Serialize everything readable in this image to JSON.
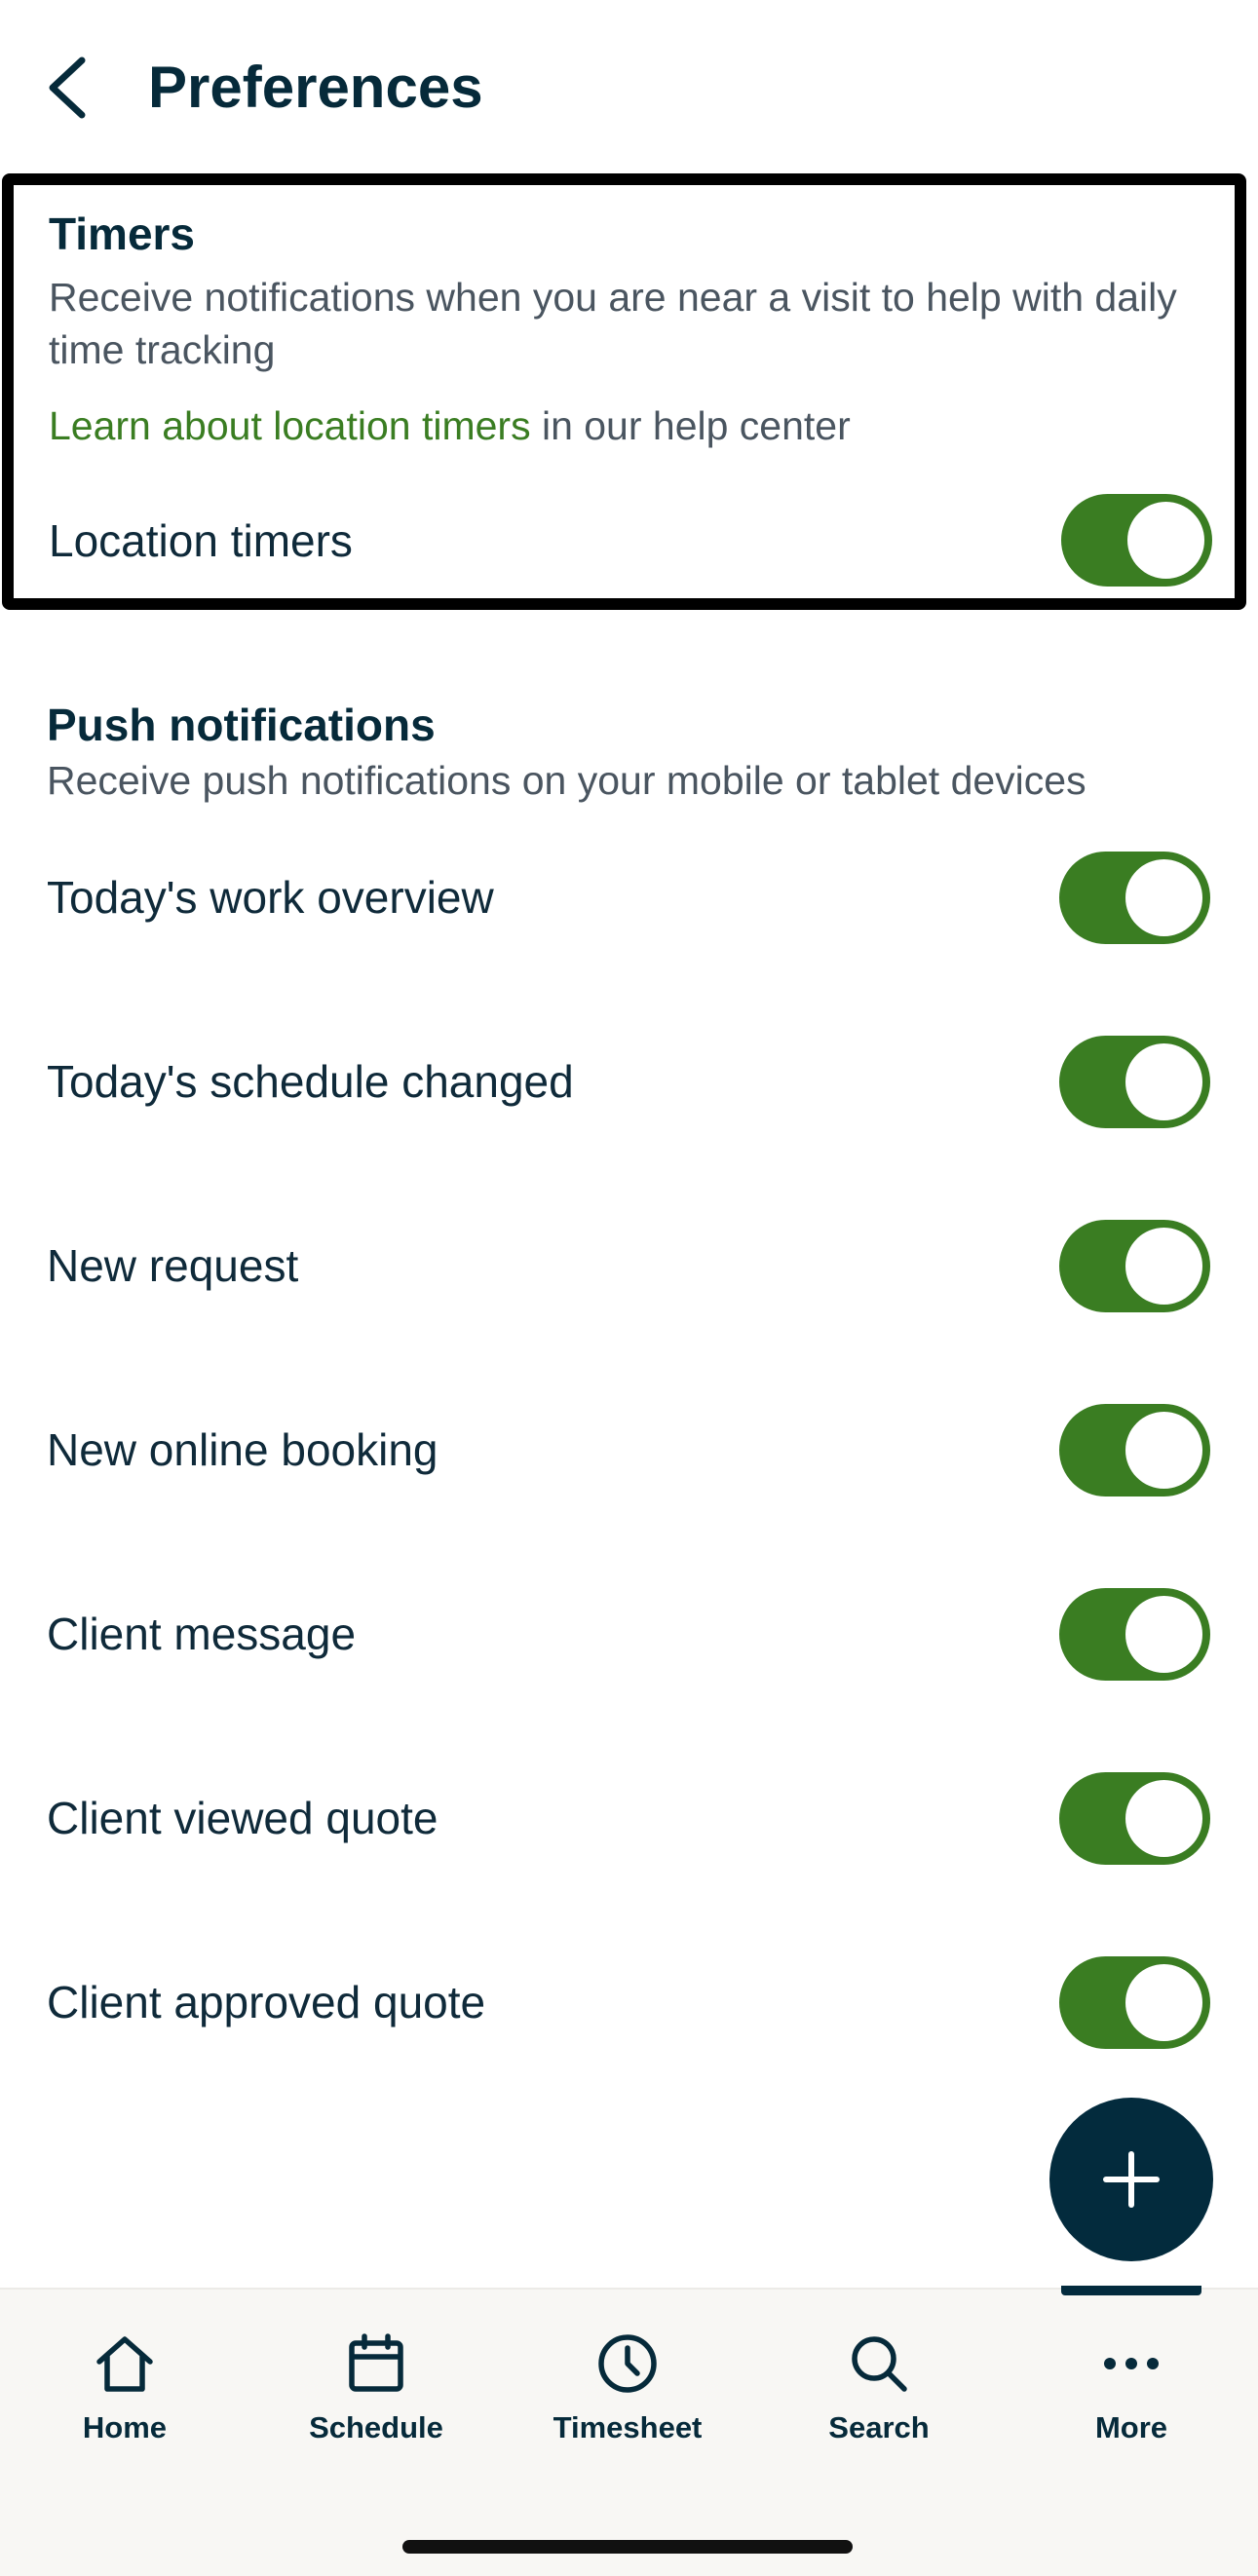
{
  "header": {
    "title": "Preferences"
  },
  "timers": {
    "title": "Timers",
    "description": "Receive notifications when you are near a visit to help with daily time tracking",
    "help_link": "Learn about location timers",
    "help_suffix": " in our help center",
    "toggle": {
      "label": "Location timers",
      "on": true
    }
  },
  "push": {
    "title": "Push notifications",
    "description": "Receive push notifications on your mobile or tablet devices",
    "items": [
      {
        "label": "Today's work overview",
        "on": true
      },
      {
        "label": "Today's schedule changed",
        "on": true
      },
      {
        "label": "New request",
        "on": true
      },
      {
        "label": "New online booking",
        "on": true
      },
      {
        "label": "Client message",
        "on": true
      },
      {
        "label": "Client viewed quote",
        "on": true
      },
      {
        "label": "Client approved quote",
        "on": true
      }
    ]
  },
  "fab": {
    "icon": "plus-icon"
  },
  "nav": {
    "active": "More",
    "items": [
      {
        "label": "Home",
        "icon": "home-icon"
      },
      {
        "label": "Schedule",
        "icon": "calendar-icon"
      },
      {
        "label": "Timesheet",
        "icon": "clock-icon"
      },
      {
        "label": "Search",
        "icon": "search-icon"
      },
      {
        "label": "More",
        "icon": "more-icon"
      }
    ]
  },
  "colors": {
    "accent_green": "#3a7d22",
    "primary_dark": "#032b3d",
    "text_dark": "#0f2a3a",
    "text_muted": "#4a5560",
    "nav_background": "#f8f7f4"
  }
}
